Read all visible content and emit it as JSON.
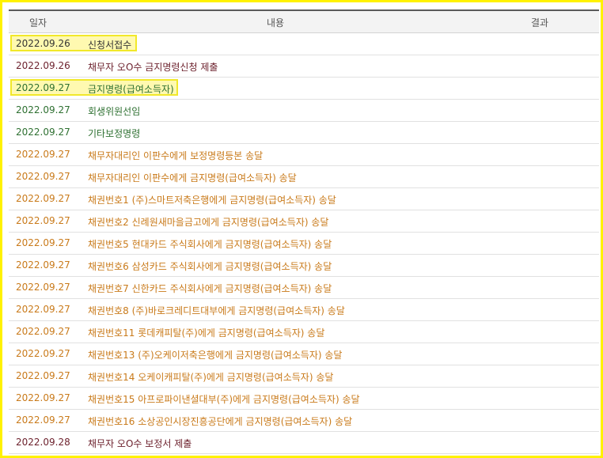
{
  "table": {
    "headers": {
      "date": "일자",
      "content": "내용",
      "result": "결과"
    },
    "rows": [
      {
        "date": "2022.09.26",
        "content": "신청서접수",
        "result": "",
        "color": "#333333",
        "highlighted": true
      },
      {
        "date": "2022.09.26",
        "content": "채무자 오O수 금지명령신청 제출",
        "result": "",
        "color": "#6b1f2b",
        "highlighted": false
      },
      {
        "date": "2022.09.27",
        "content": "금지명령(급여소득자)",
        "result": "",
        "color": "#2e7031",
        "highlighted": true
      },
      {
        "date": "2022.09.27",
        "content": "회생위원선임",
        "result": "",
        "color": "#2e7031",
        "highlighted": false
      },
      {
        "date": "2022.09.27",
        "content": "기타보정명령",
        "result": "",
        "color": "#2e7031",
        "highlighted": false
      },
      {
        "date": "2022.09.27",
        "content": "채무자대리인 이판수에게 보정명령등본 송달",
        "result": "",
        "color": "#c97a1a",
        "highlighted": false
      },
      {
        "date": "2022.09.27",
        "content": "채무자대리인 이판수에게 금지명령(급여소득자) 송달",
        "result": "",
        "color": "#c97a1a",
        "highlighted": false
      },
      {
        "date": "2022.09.27",
        "content": "채권번호1 (주)스마트저축은행에게 금지명령(급여소득자) 송달",
        "result": "",
        "color": "#c97a1a",
        "highlighted": false
      },
      {
        "date": "2022.09.27",
        "content": "채권번호2 신례원새마을금고에게 금지명령(급여소득자) 송달",
        "result": "",
        "color": "#c97a1a",
        "highlighted": false
      },
      {
        "date": "2022.09.27",
        "content": "채권번호5 현대카드 주식회사에게 금지명령(급여소득자) 송달",
        "result": "",
        "color": "#c97a1a",
        "highlighted": false
      },
      {
        "date": "2022.09.27",
        "content": "채권번호6 삼성카드 주식회사에게 금지명령(급여소득자) 송달",
        "result": "",
        "color": "#c97a1a",
        "highlighted": false
      },
      {
        "date": "2022.09.27",
        "content": "채권번호7 신한카드 주식회사에게 금지명령(급여소득자) 송달",
        "result": "",
        "color": "#c97a1a",
        "highlighted": false
      },
      {
        "date": "2022.09.27",
        "content": "채권번호8 (주)바로크레디트대부에게 금지명령(급여소득자) 송달",
        "result": "",
        "color": "#c97a1a",
        "highlighted": false
      },
      {
        "date": "2022.09.27",
        "content": "채권번호11 롯데캐피탈(주)에게 금지명령(급여소득자) 송달",
        "result": "",
        "color": "#c97a1a",
        "highlighted": false
      },
      {
        "date": "2022.09.27",
        "content": "채권번호13 (주)오케이저축은행에게 금지명령(급여소득자) 송달",
        "result": "",
        "color": "#c97a1a",
        "highlighted": false
      },
      {
        "date": "2022.09.27",
        "content": "채권번호14 오케이캐피탈(주)에게 금지명령(급여소득자) 송달",
        "result": "",
        "color": "#c97a1a",
        "highlighted": false
      },
      {
        "date": "2022.09.27",
        "content": "채권번호15 아프로파이낸셜대부(주)에게 금지명령(급여소득자) 송달",
        "result": "",
        "color": "#c97a1a",
        "highlighted": false
      },
      {
        "date": "2022.09.27",
        "content": "채권번호16 소상공인시장진흥공단에게 금지명령(급여소득자) 송달",
        "result": "",
        "color": "#c97a1a",
        "highlighted": false
      },
      {
        "date": "2022.09.28",
        "content": "채무자 오O수 보정서 제출",
        "result": "",
        "color": "#6b1f2b",
        "highlighted": false
      }
    ]
  },
  "colors": {
    "highlight_border": "#f1e82a",
    "highlight_fill": "#fff9b0",
    "outer_frame": "#fff200"
  }
}
